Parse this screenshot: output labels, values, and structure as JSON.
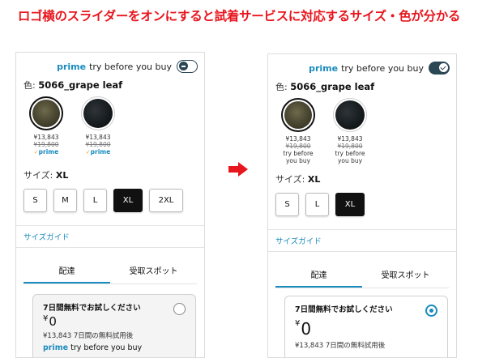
{
  "headline": "ロゴ横のスライダーをオンにすると試着サービスに対応するサイズ・色が分かる",
  "before": {
    "prime": "prime",
    "try_before_you_buy": "try before you buy",
    "toggle_state": "off",
    "color_label": "色:",
    "color_value": "5066_grape leaf",
    "swatches": [
      {
        "price": "¥13,843",
        "orig": "¥19,800",
        "badge": "prime"
      },
      {
        "price": "¥13,843",
        "orig": "¥19,800",
        "badge": "prime"
      }
    ],
    "size_label": "サイズ:",
    "size_value": "XL",
    "sizes": [
      "S",
      "M",
      "L",
      "XL",
      "2XL"
    ],
    "size_guide": "サイズガイド",
    "tabs": [
      "配達",
      "受取スポット"
    ],
    "card": {
      "title": "7日間無料でお試しください",
      "yen_symbol": "¥",
      "amount": "0",
      "trial_text": "¥13,843 7日間の無料試用後",
      "prime": "prime",
      "tbyb": "try before you buy"
    }
  },
  "after": {
    "prime": "prime",
    "try_before_you_buy": "try before you buy",
    "toggle_state": "on",
    "color_label": "色:",
    "color_value": "5066_grape leaf",
    "swatches": [
      {
        "price": "¥13,843",
        "orig": "¥19,800",
        "badge_line1": "try before",
        "badge_line2": "you buy"
      },
      {
        "price": "¥13,843",
        "orig": "¥19,800",
        "badge_line1": "try before",
        "badge_line2": "you buy"
      }
    ],
    "size_label": "サイズ:",
    "size_value": "XL",
    "sizes": [
      "S",
      "L",
      "XL"
    ],
    "size_guide": "サイズガイド",
    "tabs": [
      "配達",
      "受取スポット"
    ],
    "card": {
      "title": "7日間無料でお試しください",
      "yen_symbol": "¥",
      "amount": "0",
      "trial_text": "¥13,843 7日間の無料試用後"
    }
  },
  "colors": {
    "headline": "#e8161e",
    "prime_blue": "#1a8bbf",
    "toggle": "#2b4654",
    "arrow": "#e8161e"
  }
}
